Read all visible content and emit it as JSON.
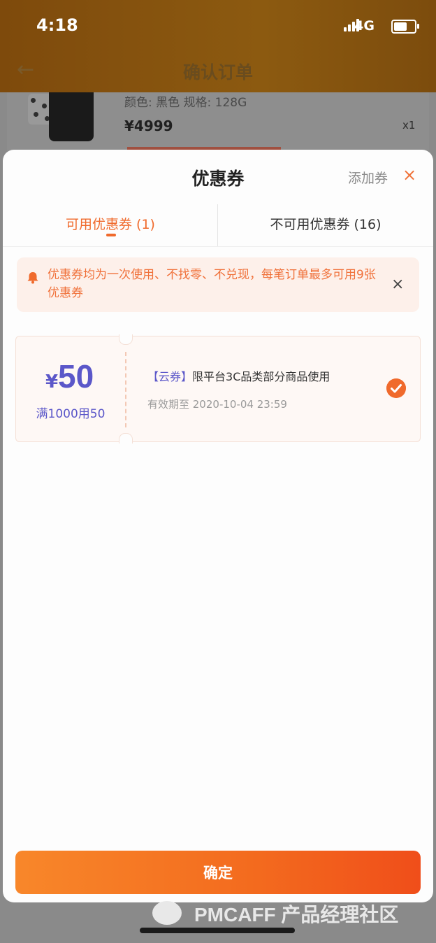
{
  "status_bar": {
    "time": "4:18",
    "network": "4G"
  },
  "nav": {
    "title": "确认订单",
    "back_icon": "arrow-left-icon"
  },
  "product": {
    "spec": "颜色: 黑色 规格: 128G",
    "price": "¥4999",
    "qty": "x1"
  },
  "sheet": {
    "title": "优惠券",
    "add_label": "添加券",
    "close_label": "×",
    "tabs": [
      {
        "label": "可用优惠券 (1)",
        "active": true
      },
      {
        "label": "不可用优惠券 (16)",
        "active": false
      }
    ],
    "notice": "优惠券均为一次使用、不找零、不兑现，每笔订单最多可用9张优惠券",
    "notice_close": "×"
  },
  "coupon": {
    "currency": "¥",
    "amount": "50",
    "condition": "满1000用50",
    "tag": "【云券】",
    "description": "限平台3C品类部分商品使用",
    "validity": "有效期至 2020-10-04 23:59",
    "selected": true,
    "accent": "#5b57c9"
  },
  "confirm_label": "确定",
  "watermark": "PMCAFF 产品经理社区",
  "colors": {
    "orange": "#f06a2c",
    "purple": "#5b57c9"
  }
}
